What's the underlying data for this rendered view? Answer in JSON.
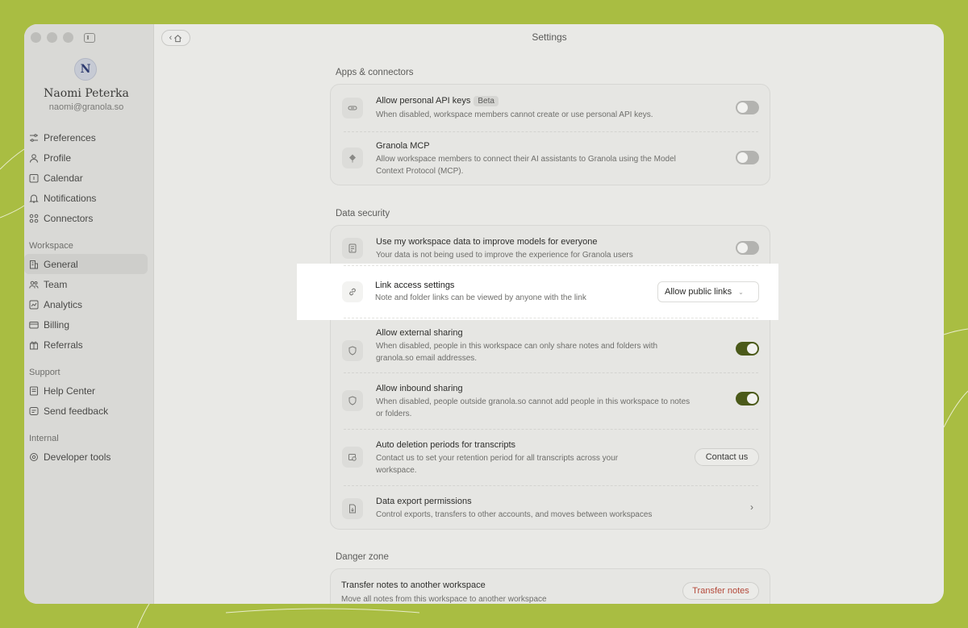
{
  "window": {
    "title": "Settings"
  },
  "user": {
    "initial": "N",
    "name": "Naomi Peterka",
    "email": "naomi@granola.so"
  },
  "sidebar": {
    "items": [
      {
        "label": "Preferences",
        "icon": "sliders-icon"
      },
      {
        "label": "Profile",
        "icon": "person-icon"
      },
      {
        "label": "Calendar",
        "icon": "calendar-icon"
      },
      {
        "label": "Notifications",
        "icon": "bell-icon"
      },
      {
        "label": "Connectors",
        "icon": "grid-icon"
      }
    ],
    "workspace_label": "Workspace",
    "workspace_items": [
      {
        "label": "General",
        "icon": "building-icon",
        "active": true
      },
      {
        "label": "Team",
        "icon": "team-icon"
      },
      {
        "label": "Analytics",
        "icon": "chart-icon"
      },
      {
        "label": "Billing",
        "icon": "card-icon"
      },
      {
        "label": "Referrals",
        "icon": "gift-icon"
      }
    ],
    "support_label": "Support",
    "support_items": [
      {
        "label": "Help Center",
        "icon": "book-icon"
      },
      {
        "label": "Send feedback",
        "icon": "message-icon"
      }
    ],
    "internal_label": "Internal",
    "internal_items": [
      {
        "label": "Developer tools",
        "icon": "gear-icon"
      }
    ]
  },
  "apps": {
    "title": "Apps & connectors",
    "api_keys": {
      "title": "Allow personal API keys",
      "badge": "Beta",
      "desc": "When disabled, workspace members cannot create or use personal API keys.",
      "enabled": false
    },
    "mcp": {
      "title": "Granola MCP",
      "desc1": "Allow workspace members to connect their AI assistants to Granola using the Model",
      "desc2": "Context Protocol (MCP).",
      "enabled": false
    }
  },
  "security": {
    "title": "Data security",
    "improve": {
      "title": "Use my workspace data to improve models for everyone",
      "desc": "Your data is not being used to improve the experience for Granola users",
      "enabled": false
    },
    "link_access": {
      "title": "Link access settings",
      "desc": "Note and folder links can be viewed by anyone with the link",
      "value": "Allow public links"
    },
    "external": {
      "title": "Allow external sharing",
      "desc1": "When disabled, people in this workspace can only share notes and folders with",
      "desc2": "granola.so email addresses.",
      "enabled": true
    },
    "inbound": {
      "title": "Allow inbound sharing",
      "desc1": "When disabled, people outside granola.so cannot add people in this workspace to notes",
      "desc2": "or folders.",
      "enabled": true
    },
    "deletion": {
      "title": "Auto deletion periods for transcripts",
      "desc1": "Contact us to set your retention period for all transcripts across your",
      "desc2": "workspace.",
      "button": "Contact us"
    },
    "export": {
      "title": "Data export permissions",
      "desc": "Control exports, transfers to other accounts, and moves between workspaces",
      "chevron": "›"
    }
  },
  "danger": {
    "title": "Danger zone",
    "transfer": {
      "title": "Transfer notes to another workspace",
      "desc": "Move all notes from this workspace to another workspace",
      "button": "Transfer notes",
      "button_color": "#b4493a"
    }
  },
  "colors": {
    "background": "#a9bd42",
    "toggle_on": "#4b5a1a"
  }
}
